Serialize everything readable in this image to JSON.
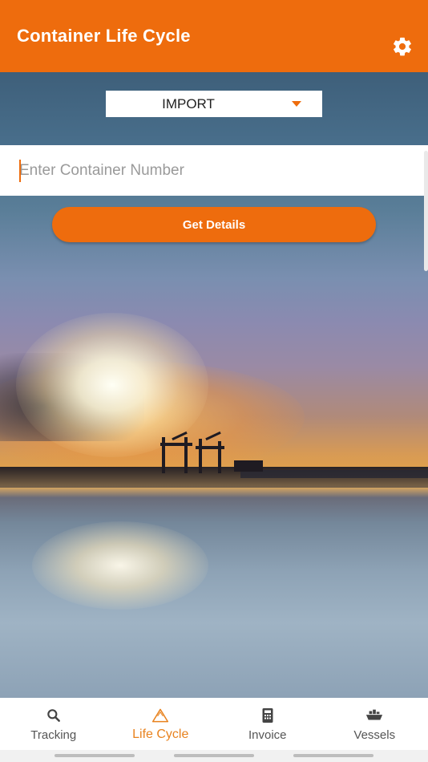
{
  "app": {
    "title": "Container Life Cycle",
    "accent_color": "#ee6c0d",
    "settings_icon": "gear-icon"
  },
  "filter": {
    "selected": "IMPORT",
    "caret_icon": "caret-down-icon"
  },
  "search": {
    "value": "",
    "placeholder": "Enter Container Number"
  },
  "actions": {
    "get_details_label": "Get Details"
  },
  "background": {
    "icon": "harbour-sunset-photo"
  },
  "bottom_nav": {
    "active": "Life Cycle",
    "items": [
      {
        "label": "Tracking",
        "icon": "search-icon"
      },
      {
        "label": "Life Cycle",
        "icon": "triangle-cycle-icon"
      },
      {
        "label": "Invoice",
        "icon": "calculator-icon"
      },
      {
        "label": "Vessels",
        "icon": "ship-icon"
      }
    ]
  }
}
